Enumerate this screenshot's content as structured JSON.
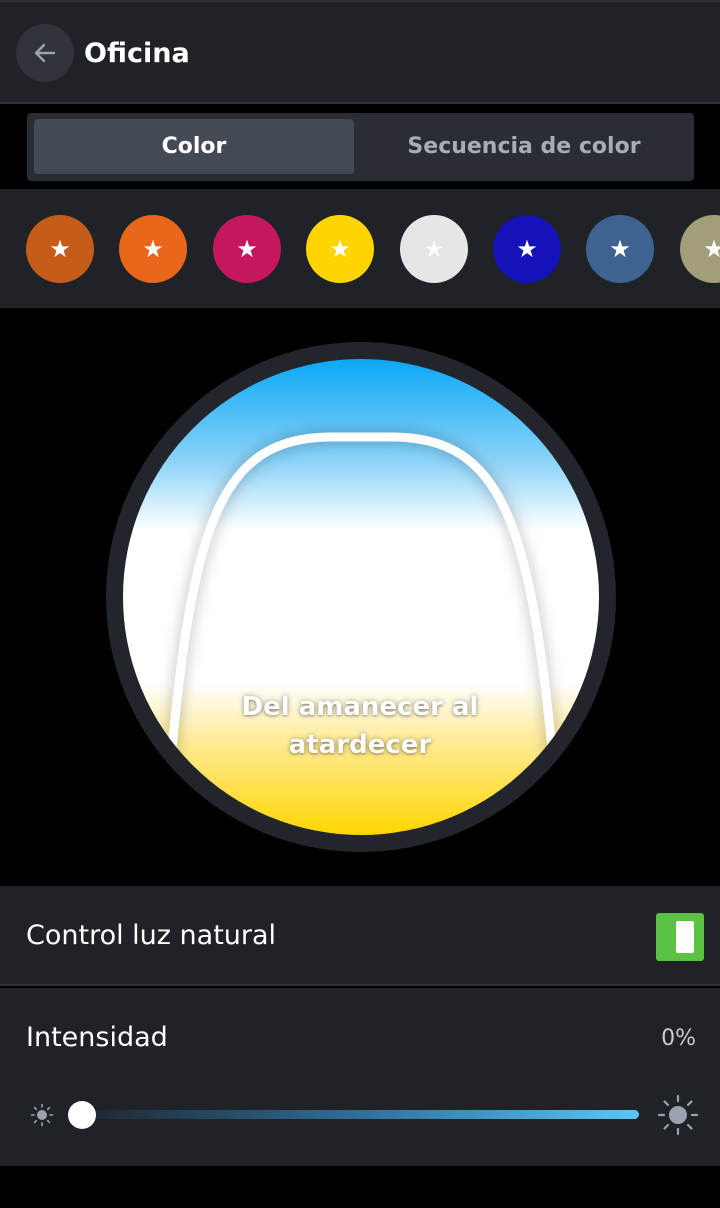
{
  "header": {
    "title": "Oficina",
    "back_icon": "arrow-left-icon"
  },
  "tabs": [
    {
      "label": "Color",
      "active": true
    },
    {
      "label": "Secuencia de color",
      "active": false
    }
  ],
  "favorites": [
    {
      "color": "#c55c1a",
      "icon": "star-icon"
    },
    {
      "color": "#e8671a",
      "icon": "star-icon"
    },
    {
      "color": "#c4175e",
      "icon": "star-icon"
    },
    {
      "color": "#ffd500",
      "icon": "star-icon"
    },
    {
      "color": "#e6e6e6",
      "icon": "star-icon"
    },
    {
      "color": "#1412b8",
      "icon": "star-icon"
    },
    {
      "color": "#3f6390",
      "icon": "star-icon"
    },
    {
      "color": "#a39e7a",
      "icon": "star-icon"
    }
  ],
  "color_wheel": {
    "label": "Del amanecer al atardecer",
    "colors": {
      "top": "#0aa8f6",
      "middle": "#ffffff",
      "bottom": "#ffd500"
    }
  },
  "natural_light": {
    "label": "Control luz natural",
    "enabled": true,
    "toggle_color": "#5cc244"
  },
  "intensity": {
    "label": "Intensidad",
    "value_text": "0%",
    "value": 0,
    "min_icon": "sun-small-icon",
    "max_icon": "sun-large-icon"
  }
}
